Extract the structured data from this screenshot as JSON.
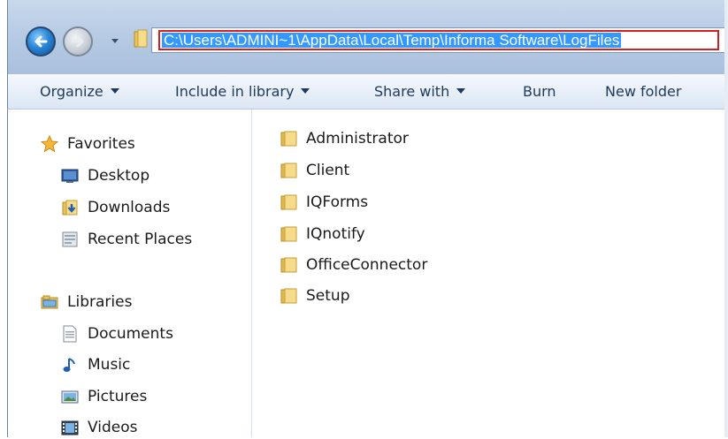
{
  "address_bar": {
    "path": "C:\\Users\\ADMINI~1\\AppData\\Local\\Temp\\Informa Software\\LogFiles"
  },
  "toolbar": {
    "organize": "Organize",
    "include_in_library": "Include in library",
    "share_with": "Share with",
    "burn": "Burn",
    "new_folder": "New folder"
  },
  "nav_pane": {
    "favorites": {
      "label": "Favorites",
      "items": [
        {
          "label": "Desktop",
          "icon": "desktop-icon"
        },
        {
          "label": "Downloads",
          "icon": "downloads-icon"
        },
        {
          "label": "Recent Places",
          "icon": "recent-places-icon"
        }
      ]
    },
    "libraries": {
      "label": "Libraries",
      "items": [
        {
          "label": "Documents",
          "icon": "documents-icon"
        },
        {
          "label": "Music",
          "icon": "music-icon"
        },
        {
          "label": "Pictures",
          "icon": "pictures-icon"
        },
        {
          "label": "Videos",
          "icon": "videos-icon"
        }
      ]
    }
  },
  "folders": [
    {
      "name": "Administrator"
    },
    {
      "name": "Client"
    },
    {
      "name": "IQForms"
    },
    {
      "name": "IQnotify"
    },
    {
      "name": "OfficeConnector"
    },
    {
      "name": "Setup"
    }
  ],
  "colors": {
    "address_selection": "#3399ff",
    "highlight_box": "#d31f1f",
    "toolbar_text": "#1e395b"
  }
}
